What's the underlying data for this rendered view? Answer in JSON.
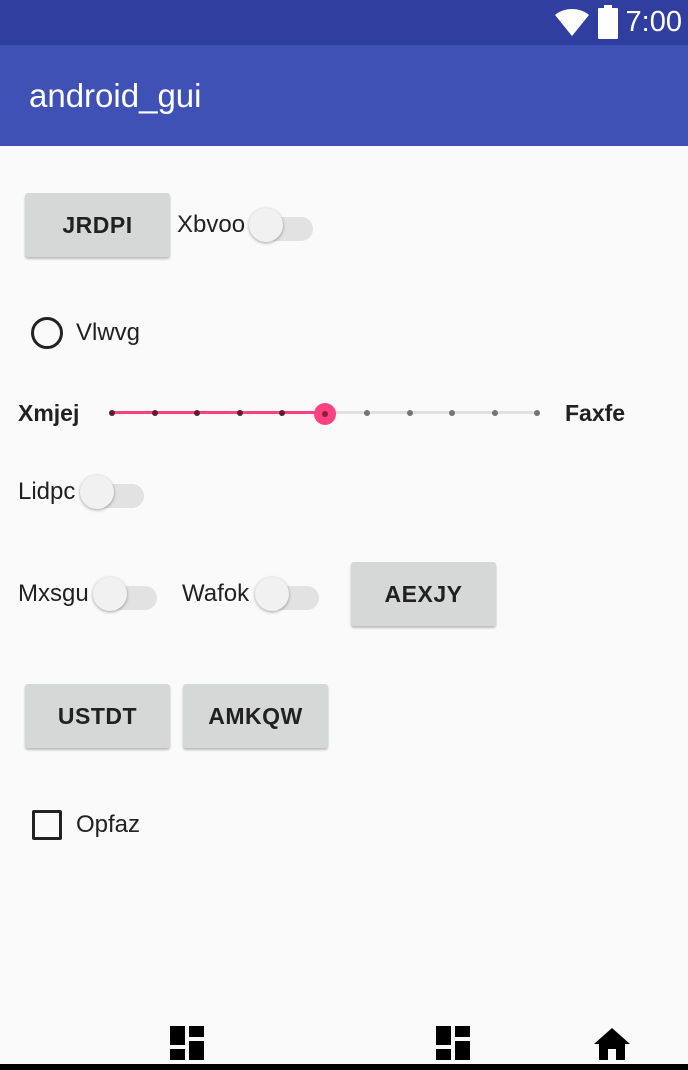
{
  "status_bar": {
    "time": "7:00",
    "icons": [
      "wifi-icon",
      "battery-icon"
    ]
  },
  "app_bar": {
    "title": "android_gui"
  },
  "buttons": {
    "jrdpi": "JRDPI",
    "aexjy": "AEXJY",
    "ustdt": "USTDT",
    "amkqw": "AMKQW"
  },
  "switches": {
    "xbvoo": "Xbvoo",
    "lidpc": "Lidpc",
    "mxsgu": "Mxsgu",
    "wafok": "Wafok"
  },
  "radio": {
    "label": "Vlwvg",
    "checked": false
  },
  "checkbox": {
    "label": "Opfaz",
    "checked": false
  },
  "slider": {
    "left_label": "Xmjej",
    "right_label": "Faxfe",
    "steps": 11,
    "value_index": 5,
    "active_color": "#ff4081"
  },
  "bottom_nav": {
    "icons": [
      "dashboard-icon",
      "dashboard-icon",
      "home-icon"
    ]
  },
  "colors": {
    "status_bar": "#303f9f",
    "app_bar": "#3f51b5",
    "accent": "#ff4081"
  }
}
